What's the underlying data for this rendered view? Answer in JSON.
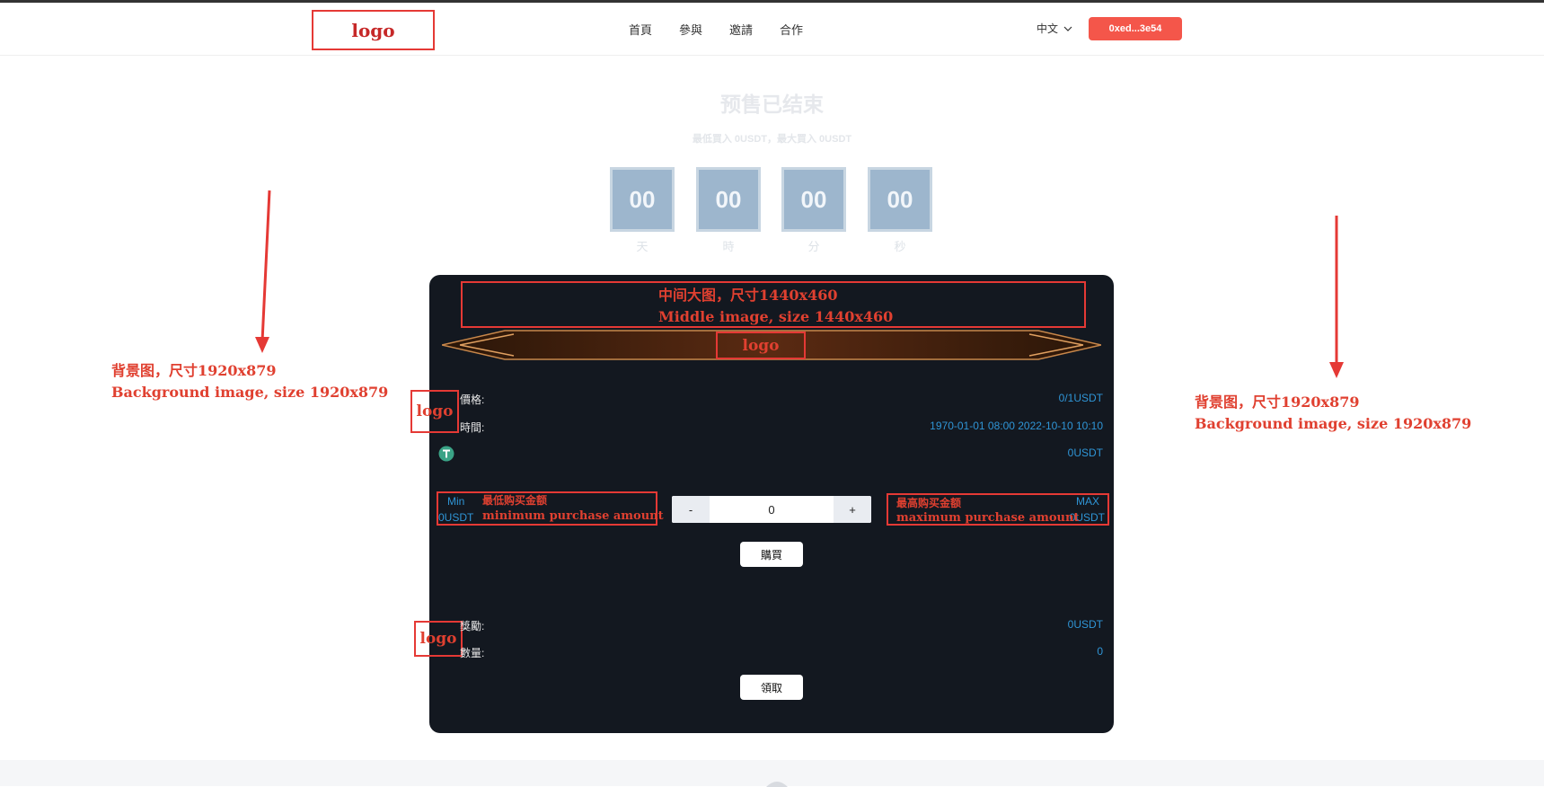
{
  "header": {
    "logo_label": "logo",
    "nav": [
      "首頁",
      "參與",
      "邀請",
      "合作"
    ],
    "language": "中文",
    "wallet": "0xed...3e54"
  },
  "presale": {
    "title": "预售已结束",
    "subtitle": "最低買入 0USDT，最大買入 0USDT",
    "countdown": [
      {
        "value": "00",
        "unit": "天"
      },
      {
        "value": "00",
        "unit": "時"
      },
      {
        "value": "00",
        "unit": "分"
      },
      {
        "value": "00",
        "unit": "秒"
      }
    ]
  },
  "annotations": {
    "bg_left_cn": "背景图，尺寸1920x879",
    "bg_left_en": "Background image, size 1920x879",
    "bg_right_cn": "背景图，尺寸1920x879",
    "bg_right_en": "Background image, size 1920x879",
    "middle_cn": "中间大图，尺寸1440x460",
    "middle_en": "Middle image, size 1440x460",
    "banner_logo": "logo",
    "side_logo_1": "logo",
    "side_logo_2": "logo",
    "min_cn": "最低购买金额",
    "min_en": "minimum purchase amount",
    "max_cn": "最高购买金额",
    "max_en": "maximum purchase amount"
  },
  "panel": {
    "price_label": "價格:",
    "price_value": "0/1USDT",
    "time_label": "時間:",
    "time_value": "1970-01-01 08:00 2022-10-10 10:10",
    "token_value": "0USDT",
    "min_label": "Min",
    "min_value": "0USDT",
    "max_label": "MAX",
    "max_value": "0USDT",
    "stepper": {
      "minus": "-",
      "plus": "+",
      "value": "0"
    },
    "buy_button": "購買",
    "reward_label": "獎勵:",
    "reward_value": "0USDT",
    "quantity_label": "數量:",
    "quantity_value": "0",
    "claim_button": "領取"
  },
  "colors": {
    "accent": "#f4564a",
    "panel_bg": "#131820",
    "value_blue": "#2f95d6",
    "annotation_red": "#e04030"
  }
}
